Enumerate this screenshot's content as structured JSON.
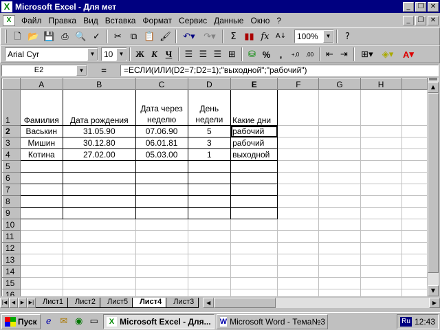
{
  "window": {
    "title": "Microsoft Excel - Для мет",
    "controls": [
      "_",
      "❐",
      "✕"
    ]
  },
  "menu": {
    "items": [
      "Файл",
      "Правка",
      "Вид",
      "Вставка",
      "Формат",
      "Сервис",
      "Данные",
      "Окно",
      "?"
    ],
    "doc_controls": [
      "_",
      "❐",
      "✕"
    ]
  },
  "toolbar": {
    "zoom": "100%",
    "icons": [
      "new-icon",
      "open-icon",
      "save-icon",
      "print-icon",
      "print-preview-icon",
      "spelling-icon",
      "cut-icon",
      "copy-icon",
      "paste-icon",
      "format-painter-icon",
      "undo-icon",
      "redo-icon",
      "autosum-icon",
      "chart-wizard-icon",
      "function-icon",
      "sort-ascending-icon",
      "help-icon"
    ]
  },
  "format": {
    "font_name": "Arial Cyr",
    "font_size": "10",
    "bold": "Ж",
    "italic": "К",
    "underline": "Ч",
    "percent": "%",
    "comma": ",",
    "inc_decimal": ",00 +,0",
    "dec_decimal": ",00 ,0",
    "font_color_letter": "A"
  },
  "formula_bar": {
    "cell_ref": "E2",
    "equals": "=",
    "formula": "=ЕСЛИ(ИЛИ(D2=7;D2=1);\"выходной\";\"рабочий\")"
  },
  "sheet": {
    "columns": [
      "A",
      "B",
      "C",
      "D",
      "E",
      "F",
      "G",
      "H"
    ],
    "header_row": {
      "a": "Фамилия",
      "b": "Дата рождения",
      "c": "Дата через неделю",
      "d": "День недели",
      "e": "Какие дни"
    },
    "rows": [
      {
        "num": "2",
        "a": "Васькин",
        "b": "31.05.90",
        "c": "07.06.90",
        "d": "5",
        "e": "рабочий"
      },
      {
        "num": "3",
        "a": "Мишин",
        "b": "30.12.80",
        "c": "06.01.81",
        "d": "3",
        "e": "рабочий"
      },
      {
        "num": "4",
        "a": "Котина",
        "b": "27.02.00",
        "c": "05.03.00",
        "d": "1",
        "e": "выходной"
      }
    ],
    "row_numbers": [
      "1",
      "5",
      "6",
      "7",
      "8",
      "9",
      "10",
      "11",
      "12",
      "13",
      "14",
      "15",
      "16"
    ]
  },
  "tabs": [
    "Лист1",
    "Лист2",
    "Лист5",
    "Лист4",
    "Лист3"
  ],
  "active_tab": "Лист4",
  "taskbar": {
    "start": "Пуск",
    "tasks": [
      "Microsoft Excel - Для...",
      "Microsoft Word - Тема№3"
    ],
    "lang": "Ru",
    "clock": "12:43"
  }
}
